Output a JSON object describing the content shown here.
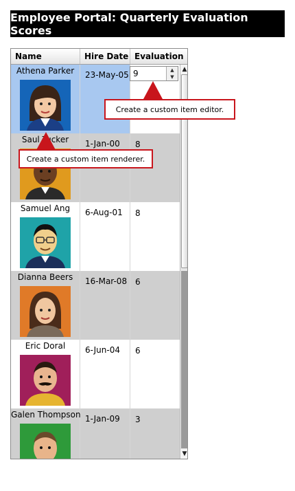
{
  "title": "Employee Portal: Quarterly Evaluation Scores",
  "columns": {
    "name": "Name",
    "hire_date": "Hire Date",
    "evaluation": "Evaluation"
  },
  "rows": [
    {
      "name": "Athena Parker",
      "hire_date": "23-May-05",
      "evaluation": "9",
      "avatar": "woman-portrait-icon",
      "bg": "#1565b8"
    },
    {
      "name": "Saul Tucker",
      "hire_date": "1-Jan-00",
      "evaluation": "8",
      "avatar": "man-portrait-icon",
      "bg": "#e09a1e"
    },
    {
      "name": "Samuel Ang",
      "hire_date": "6-Aug-01",
      "evaluation": "8",
      "avatar": "man-glasses-portrait-icon",
      "bg": "#1fa3a8"
    },
    {
      "name": "Dianna Beers",
      "hire_date": "16-Mar-08",
      "evaluation": "6",
      "avatar": "woman-portrait-icon",
      "bg": "#e07a28"
    },
    {
      "name": "Eric Doral",
      "hire_date": "6-Jun-04",
      "evaluation": "6",
      "avatar": "man-mustache-portrait-icon",
      "bg": "#a01f5a"
    },
    {
      "name": "Galen Thompson",
      "hire_date": "1-Jan-09",
      "evaluation": "3",
      "avatar": "man-portrait-icon",
      "bg": "#2e9a3a"
    }
  ],
  "editor": {
    "value": "9"
  },
  "callouts": {
    "editor": "Create a custom item editor.",
    "renderer": "Create a custom item renderer."
  },
  "colors": {
    "accent": "#c8151c",
    "selection": "#a8c8f0",
    "alt_row": "#cfcfcf"
  }
}
